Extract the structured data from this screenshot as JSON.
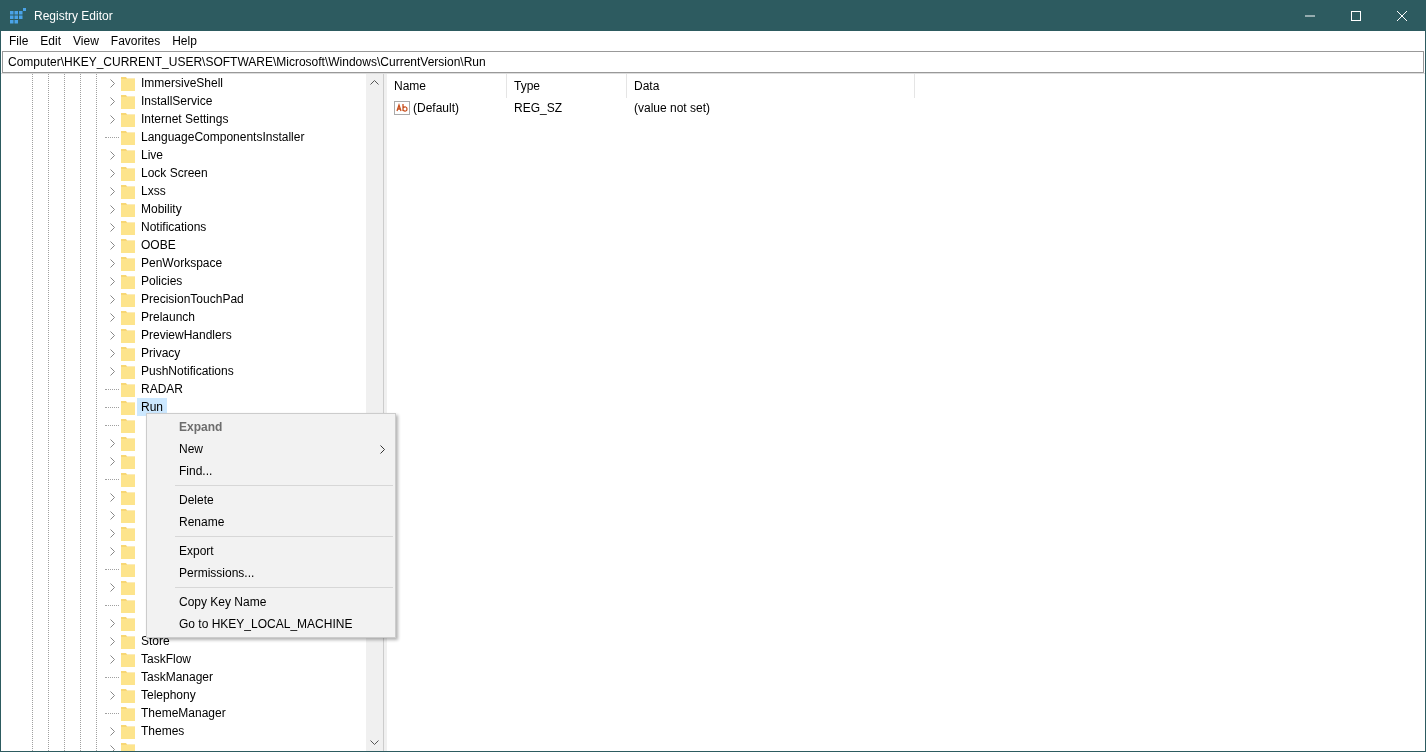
{
  "window": {
    "title": "Registry Editor"
  },
  "menu_bar": [
    "File",
    "Edit",
    "View",
    "Favorites",
    "Help"
  ],
  "address": "Computer\\HKEY_CURRENT_USER\\SOFTWARE\\Microsoft\\Windows\\CurrentVersion\\Run",
  "tree": [
    {
      "label": "ImmersiveShell",
      "expandable": true,
      "selected": false
    },
    {
      "label": "InstallService",
      "expandable": true,
      "selected": false
    },
    {
      "label": "Internet Settings",
      "expandable": true,
      "selected": false
    },
    {
      "label": "LanguageComponentsInstaller",
      "expandable": false,
      "selected": false
    },
    {
      "label": "Live",
      "expandable": true,
      "selected": false
    },
    {
      "label": "Lock Screen",
      "expandable": true,
      "selected": false
    },
    {
      "label": "Lxss",
      "expandable": true,
      "selected": false
    },
    {
      "label": "Mobility",
      "expandable": true,
      "selected": false
    },
    {
      "label": "Notifications",
      "expandable": true,
      "selected": false
    },
    {
      "label": "OOBE",
      "expandable": true,
      "selected": false
    },
    {
      "label": "PenWorkspace",
      "expandable": true,
      "selected": false
    },
    {
      "label": "Policies",
      "expandable": true,
      "selected": false
    },
    {
      "label": "PrecisionTouchPad",
      "expandable": true,
      "selected": false
    },
    {
      "label": "Prelaunch",
      "expandable": true,
      "selected": false
    },
    {
      "label": "PreviewHandlers",
      "expandable": true,
      "selected": false
    },
    {
      "label": "Privacy",
      "expandable": true,
      "selected": false
    },
    {
      "label": "PushNotifications",
      "expandable": true,
      "selected": false
    },
    {
      "label": "RADAR",
      "expandable": false,
      "selected": false
    },
    {
      "label": "Run",
      "expandable": false,
      "selected": true
    },
    {
      "expandable": false
    },
    {
      "expandable": true
    },
    {
      "expandable": true
    },
    {
      "expandable": false
    },
    {
      "expandable": true
    },
    {
      "expandable": true
    },
    {
      "expandable": true
    },
    {
      "expandable": true
    },
    {
      "expandable": false
    },
    {
      "expandable": true
    },
    {
      "expandable": false
    },
    {
      "expandable": true
    },
    {
      "label": "Store",
      "expandable": true,
      "selected": false
    },
    {
      "label": "TaskFlow",
      "expandable": true,
      "selected": false
    },
    {
      "label": "TaskManager",
      "expandable": false,
      "selected": false
    },
    {
      "label": "Telephony",
      "expandable": true,
      "selected": false
    },
    {
      "label": "ThemeManager",
      "expandable": false,
      "selected": false
    },
    {
      "label": "Themes",
      "expandable": true,
      "selected": false
    },
    {
      "expandable": true
    }
  ],
  "values": {
    "columns": [
      "Name",
      "Type",
      "Data"
    ],
    "rows": [
      {
        "name": "(Default)",
        "type": "REG_SZ",
        "data": "(value not set)"
      }
    ]
  },
  "context_menu": [
    {
      "kind": "item",
      "label": "Expand",
      "disabled": true,
      "default": true,
      "submenu": false
    },
    {
      "kind": "item",
      "label": "New",
      "disabled": false,
      "default": false,
      "submenu": true
    },
    {
      "kind": "item",
      "label": "Find...",
      "disabled": false,
      "default": false,
      "submenu": false
    },
    {
      "kind": "separator"
    },
    {
      "kind": "item",
      "label": "Delete",
      "disabled": false,
      "default": false,
      "submenu": false
    },
    {
      "kind": "item",
      "label": "Rename",
      "disabled": false,
      "default": false,
      "submenu": false
    },
    {
      "kind": "separator"
    },
    {
      "kind": "item",
      "label": "Export",
      "disabled": false,
      "default": false,
      "submenu": false
    },
    {
      "kind": "item",
      "label": "Permissions...",
      "disabled": false,
      "default": false,
      "submenu": false
    },
    {
      "kind": "separator"
    },
    {
      "kind": "item",
      "label": "Copy Key Name",
      "disabled": false,
      "default": false,
      "submenu": false
    },
    {
      "kind": "item",
      "label": "Go to HKEY_LOCAL_MACHINE",
      "disabled": false,
      "default": false,
      "submenu": false
    }
  ]
}
